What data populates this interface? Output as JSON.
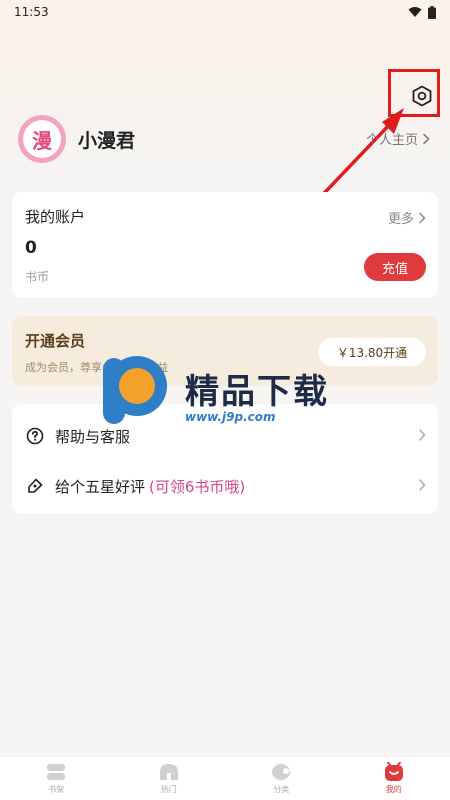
{
  "status_bar": {
    "time": "11:53"
  },
  "profile": {
    "avatar_text": "漫",
    "username": "小漫君",
    "homepage_label": "个人主页"
  },
  "account": {
    "title": "我的账户",
    "more_label": "更多",
    "coin_value": "0",
    "coin_label": "书币",
    "recharge_label": "充值"
  },
  "vip": {
    "title": "开通会员",
    "description": "成为会员，尊享会员特等权益",
    "price_button": "￥13.80开通"
  },
  "watermark": {
    "text": "精品下载",
    "url": "www.j9p.com"
  },
  "menu": {
    "help_label": "帮助与客服",
    "rate_label": "给个五星好评",
    "rate_highlight": "(可领6书币哦)"
  },
  "tabs": [
    {
      "label": "书架",
      "icon": "bookshelf-icon"
    },
    {
      "label": "热门",
      "icon": "hot-icon"
    },
    {
      "label": "分类",
      "icon": "category-icon"
    },
    {
      "label": "我的",
      "icon": "profile-icon"
    }
  ],
  "colors": {
    "accent": "#e03a3c",
    "vip_bg": "#f6ecdd",
    "highlight_pink": "#d8458f",
    "annotation_red": "#e01b1b"
  }
}
